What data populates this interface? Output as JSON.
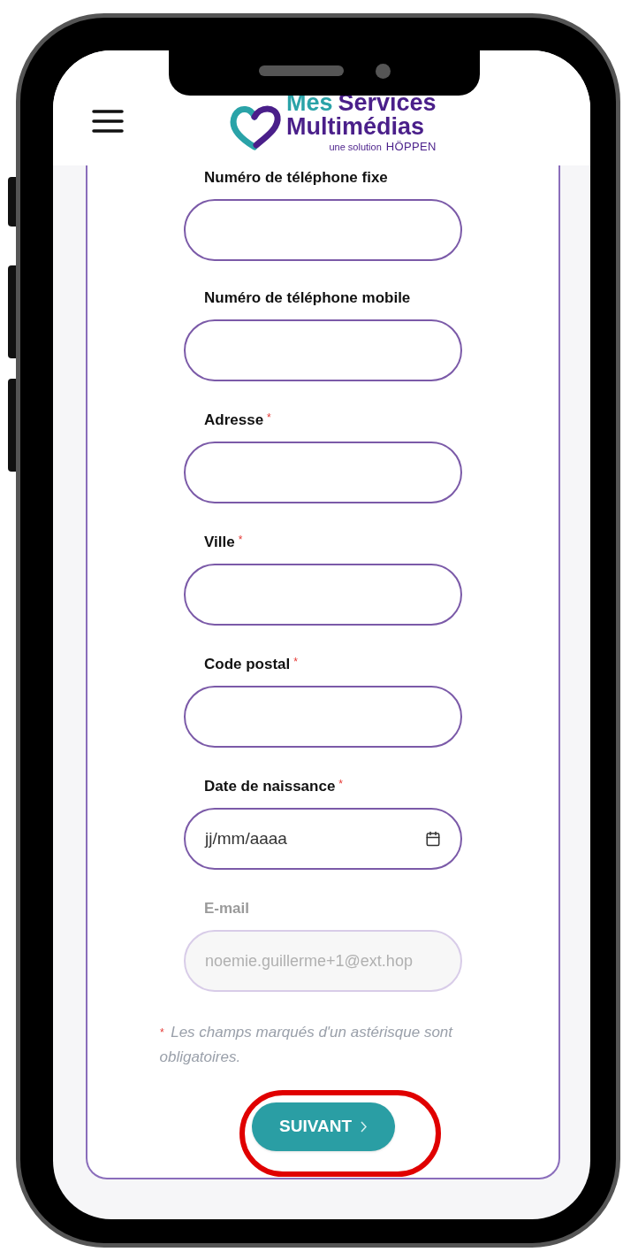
{
  "header": {
    "logo": {
      "word_1": "Mes",
      "word_2": "Services",
      "line_2": "Multimédias",
      "tagline": "une solution",
      "brand": "HÖPPEN"
    }
  },
  "form": {
    "fields": [
      {
        "kind": "text",
        "label": "Numéro de téléphone fixe"
      },
      {
        "kind": "text",
        "label": "Numéro de téléphone mobile"
      },
      {
        "kind": "text",
        "label": "Adresse",
        "asterisk": "*"
      },
      {
        "kind": "text",
        "label": "Ville",
        "asterisk": "*"
      },
      {
        "kind": "text",
        "label": "Code postal",
        "asterisk": "*"
      },
      {
        "kind": "date",
        "label": "Date de naissance",
        "asterisk": "*",
        "placeholder": "jj/mm/aaaa"
      },
      {
        "kind": "disabled",
        "label": "E-mail",
        "value": "noemie.guillerme+1@ext.hop"
      }
    ],
    "footnote": {
      "asterisk": "*",
      "text": "Les champs marqués d'un astérisque sont obligatoires."
    },
    "next_button": {
      "label": "SUIVANT",
      "highlighted": true
    }
  }
}
